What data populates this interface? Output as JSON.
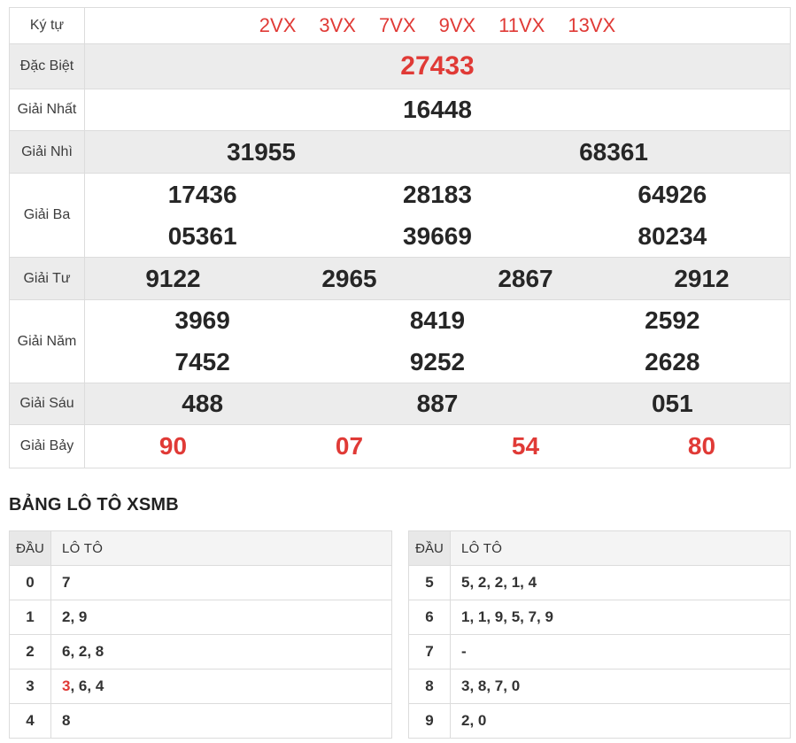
{
  "colors": {
    "red": "#e03a36",
    "alt_row_bg": "#ececec",
    "border": "#dcdcdc"
  },
  "results": {
    "rows": [
      {
        "label": "Ký tự",
        "values": [
          "2VX",
          "3VX",
          "7VX",
          "9VX",
          "11VX",
          "13VX"
        ]
      },
      {
        "label": "Đặc Biệt",
        "values": [
          "27433"
        ]
      },
      {
        "label": "Giải Nhất",
        "values": [
          "16448"
        ]
      },
      {
        "label": "Giải Nhì",
        "values": [
          "31955",
          "68361"
        ]
      },
      {
        "label": "Giải Ba",
        "values": [
          "17436",
          "28183",
          "64926",
          "05361",
          "39669",
          "80234"
        ]
      },
      {
        "label": "Giải Tư",
        "values": [
          "9122",
          "2965",
          "2867",
          "2912"
        ]
      },
      {
        "label": "Giải Năm",
        "values": [
          "3969",
          "8419",
          "2592",
          "7452",
          "9252",
          "2628"
        ]
      },
      {
        "label": "Giải Sáu",
        "values": [
          "488",
          "887",
          "051"
        ]
      },
      {
        "label": "Giải Bảy",
        "values": [
          "90",
          "07",
          "54",
          "80"
        ]
      }
    ]
  },
  "loto": {
    "heading": "BẢNG LÔ TÔ XSMB",
    "headers": {
      "dau": "ĐẦU",
      "loto": "LÔ TÔ"
    },
    "left_rows": [
      {
        "dau": "0",
        "red": "",
        "text": "7"
      },
      {
        "dau": "1",
        "red": "",
        "text": "2, 9"
      },
      {
        "dau": "2",
        "red": "",
        "text": "6, 2, 8"
      },
      {
        "dau": "3",
        "red": "3",
        "text": ", 6, 4"
      },
      {
        "dau": "4",
        "red": "",
        "text": "8"
      }
    ],
    "right_rows": [
      {
        "dau": "5",
        "red": "",
        "text": "5, 2, 2, 1, 4"
      },
      {
        "dau": "6",
        "red": "",
        "text": "1, 1, 9, 5, 7, 9"
      },
      {
        "dau": "7",
        "red": "",
        "text": "-"
      },
      {
        "dau": "8",
        "red": "",
        "text": "3, 8, 7, 0"
      },
      {
        "dau": "9",
        "red": "",
        "text": "2, 0"
      }
    ]
  }
}
